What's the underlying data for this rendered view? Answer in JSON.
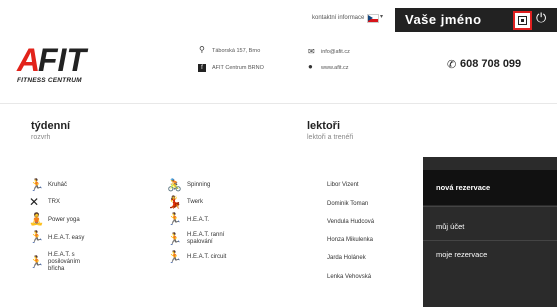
{
  "topbar": {
    "contact_link": "kontaktní informace",
    "user_name": "Vaše jméno",
    "profile_icon": "profile-card-icon",
    "power_icon": "power-icon"
  },
  "logo": {
    "a": "A",
    "fit": "FIT",
    "sub": "FITNESS CENTRUM"
  },
  "contact": {
    "address": "Táborská 157, Brno",
    "facebook": "AFIT Centrum BRNO",
    "email": "info@afit.cz",
    "web": "www.afit.cz",
    "phone": "608 708 099"
  },
  "weekly": {
    "title": "týdenní",
    "subtitle": "rozvrh"
  },
  "lectors_section": {
    "title": "lektoři",
    "subtitle": "lektoři a trenéři"
  },
  "lessons_col1": [
    "Kruháč",
    "TRX",
    "Power yoga",
    "H.E.A.T. easy",
    "H.E.A.T. s posilováním břicha"
  ],
  "lessons_col2": [
    "Spinning",
    "Twerk",
    "H.E.A.T.",
    "H.E.A.T. ranní spalování",
    "H.E.A.T. circuit"
  ],
  "lectors": [
    "Libor Vizent",
    "Dominik Toman",
    "Vendula Hudcová",
    "Honza Mikulenka",
    "Jarda Holánek",
    "Lenka Vehovská"
  ],
  "menu": {
    "new_reservation": "nová rezervace",
    "my_account": "můj účet",
    "my_reservations": "moje rezervace"
  }
}
